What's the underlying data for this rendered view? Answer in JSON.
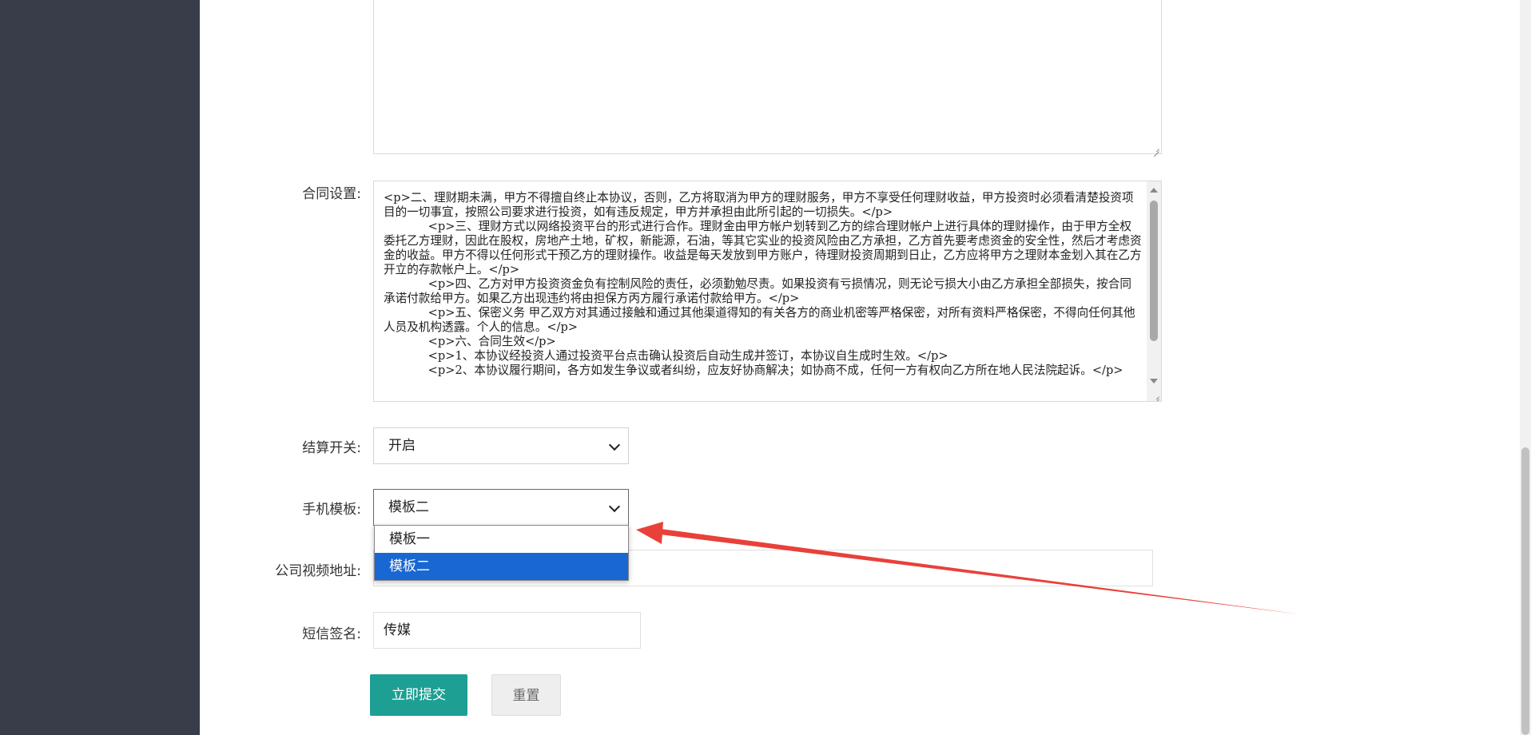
{
  "form": {
    "contract": {
      "label": "合同设置:",
      "value": "<p>二、理财期未满，甲方不得擅自终止本协议，否则，乙方将取消为甲方的理财服务，甲方不享受任何理财收益，甲方投资时必须看清楚投资项目的一切事宜，按照公司要求进行投资，如有违反规定，甲方并承担由此所引起的一切损失。</p>\n            <p>三、理财方式以网络投资平台的形式进行合作。理财金由甲方帐户划转到乙方的综合理财帐户上进行具体的理财操作，由于甲方全权委托乙方理财，因此在股权，房地产土地，矿权，新能源，石油，等其它实业的投资风险由乙方承担，乙方首先要考虑资金的安全性，然后才考虑资金的收益。甲方不得以任何形式干预乙方的理财操作。收益是每天发放到甲方账户，待理财投资周期到日止，乙方应将甲方之理财本金划入其在乙方开立的存款帐户上。</p>\n            <p>四、乙方对甲方投资资金负有控制风险的责任，必须勤勉尽责。如果投资有亏损情况，则无论亏损大小由乙方承担全部损失，按合同承诺付款给甲方。如果乙方出现违约将由担保方丙方履行承诺付款给甲方。</p>\n            <p>五、保密义务 甲乙双方对其通过接触和通过其他渠道得知的有关各方的商业机密等严格保密，对所有资料严格保密，不得向任何其他人员及机构透露。个人的信息。</p>\n            <p>六、合同生效</p>\n            <p>1、本协议经投资人通过投资平台点击确认投资后自动生成并签订，本协议自生成时生效。</p>\n            <p>2、本协议履行期间，各方如发生争议或者纠纷，应友好协商解决；如协商不成，任何一方有权向乙方所在地人民法院起诉。</p>"
    },
    "settlement": {
      "label": "结算开关:",
      "value": "开启"
    },
    "mobile_template": {
      "label": "手机模板:",
      "value": "模板二",
      "options": [
        "模板一",
        "模板二"
      ],
      "selected_index": 1
    },
    "company_video": {
      "label": "公司视频地址:",
      "value": ""
    },
    "sms_signature": {
      "label": "短信签名:",
      "value": "传媒"
    },
    "submit_label": "立即提交",
    "reset_label": "重置"
  },
  "colors": {
    "sidebar": "#393d49",
    "primary": "#1e9f94",
    "dropdown_highlight": "#1967d2",
    "annotation_arrow": "#e8413a"
  }
}
